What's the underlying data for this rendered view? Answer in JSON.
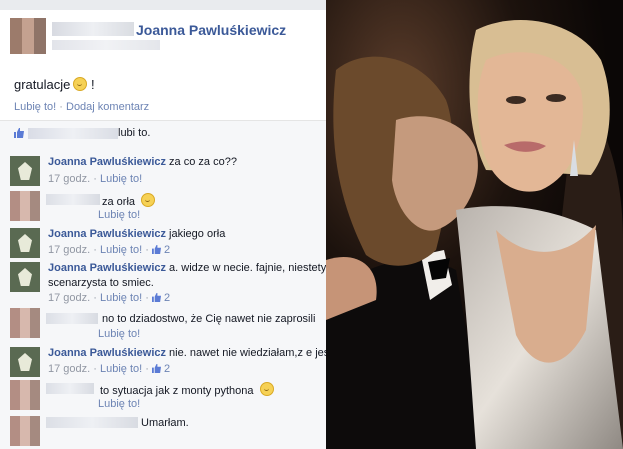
{
  "post": {
    "poster_name": "Joanna Pawluśkiewicz",
    "text": "gratulacje",
    "actions": {
      "like": "Lubię to!",
      "separator": "·",
      "comment": "Dodaj komentarz"
    },
    "likes_suffix": "lubi to."
  },
  "comments": [
    {
      "author": "Joanna Pawluśkiewicz",
      "text": " za co za co??",
      "time": "17 godz.",
      "like": "Lubię to!",
      "likes": ""
    },
    {
      "author": "",
      "text": "za orła",
      "time": "",
      "like": "Lubię to!",
      "likes": ""
    },
    {
      "author": "Joanna Pawluśkiewicz",
      "text": " jakiego orła",
      "time": "17 godz.",
      "like": "Lubię to!",
      "likes": "2"
    },
    {
      "author": "Joanna Pawluśkiewicz",
      "text": " a. widze w necie. fajnie, niestety nic n",
      "text2": "scenarzysta to smiec.",
      "time": "17 godz.",
      "like": "Lubię to!",
      "likes": "2"
    },
    {
      "author": "",
      "text": "no to dziadostwo, że Cię nawet nie zaprosili",
      "time": "",
      "like": "Lubię to!",
      "likes": ""
    },
    {
      "author": "Joanna Pawluśkiewicz",
      "text": " nie. nawet nie wiedziałam,z e jest no",
      "time": "17 godz.",
      "like": "Lubię to!",
      "likes": "2"
    },
    {
      "author": "",
      "text": "to sytuacja jak z monty pythona",
      "time": "",
      "like": "Lubię to!",
      "likes": ""
    },
    {
      "author": "",
      "text": "Umarłam.",
      "time": "",
      "like": "",
      "likes": ""
    }
  ],
  "colors": {
    "link": "#3b5998",
    "meta": "#9197a3",
    "bg": "#f6f7f9"
  },
  "icons": {
    "like": "thumbs-up-icon",
    "emoji": "smiley-icon",
    "avatar": "eagle-avatar-icon"
  }
}
